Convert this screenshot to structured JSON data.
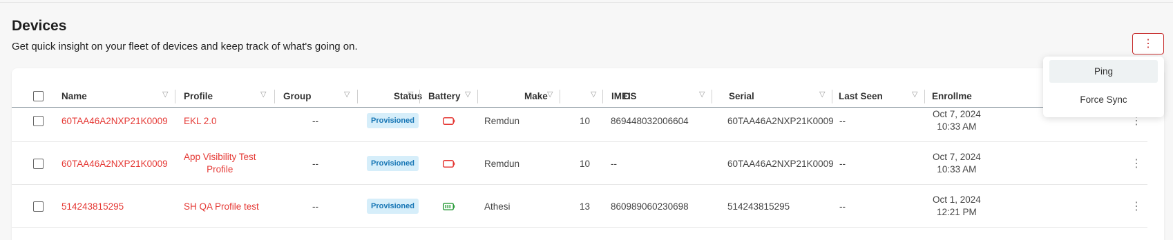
{
  "header": {
    "title": "Devices",
    "subtitle": "Get quick insight on your fleet of devices and keep track of what's going on.",
    "menu_icon": "⋮"
  },
  "table": {
    "columns": [
      "Name",
      "Profile",
      "Group",
      "Status",
      "Battery",
      "Make",
      "OS",
      "IMEI",
      "Serial",
      "Last Seen",
      "Enrollme"
    ],
    "rows": [
      {
        "name": "60TAA46A2NXP21K0009",
        "profile": "EKL 2.0",
        "group": "--",
        "status": "Provisioned",
        "battery": "battery-empty-icon",
        "make": "Remdun",
        "os": "10",
        "imei": "869448032006604",
        "serial": "60TAA46A2NXP21K0009",
        "last_seen": "--",
        "enrolled_date": "Oct 7, 2024",
        "enrolled_time": "10:33 AM"
      },
      {
        "name": "60TAA46A2NXP21K0009",
        "profile_line1": "App Visibility Test",
        "profile_line2": "Profile",
        "group": "--",
        "status": "Provisioned",
        "battery": "battery-empty-icon",
        "make": "Remdun",
        "os": "10",
        "imei": "--",
        "serial": "60TAA46A2NXP21K0009",
        "last_seen": "--",
        "enrolled_date": "Oct 7, 2024",
        "enrolled_time": "10:33 AM"
      },
      {
        "name": "514243815295",
        "profile": "SH QA Profile test",
        "group": "--",
        "status": "Provisioned",
        "battery": "battery-full-icon",
        "make": "Athesi",
        "os": "13",
        "imei": "860989060230698",
        "serial": "514243815295",
        "last_seen": "--",
        "enrolled_date": "Oct 1, 2024",
        "enrolled_time": "12:21 PM"
      }
    ]
  },
  "dropdown": {
    "items": [
      "Ping",
      "Force Sync"
    ]
  },
  "colors": {
    "accent": "#e53935",
    "badge_bg": "#d6eefa",
    "badge_text": "#1776b5",
    "battery_empty": "#e53935",
    "battery_full": "#2e9e3e"
  }
}
